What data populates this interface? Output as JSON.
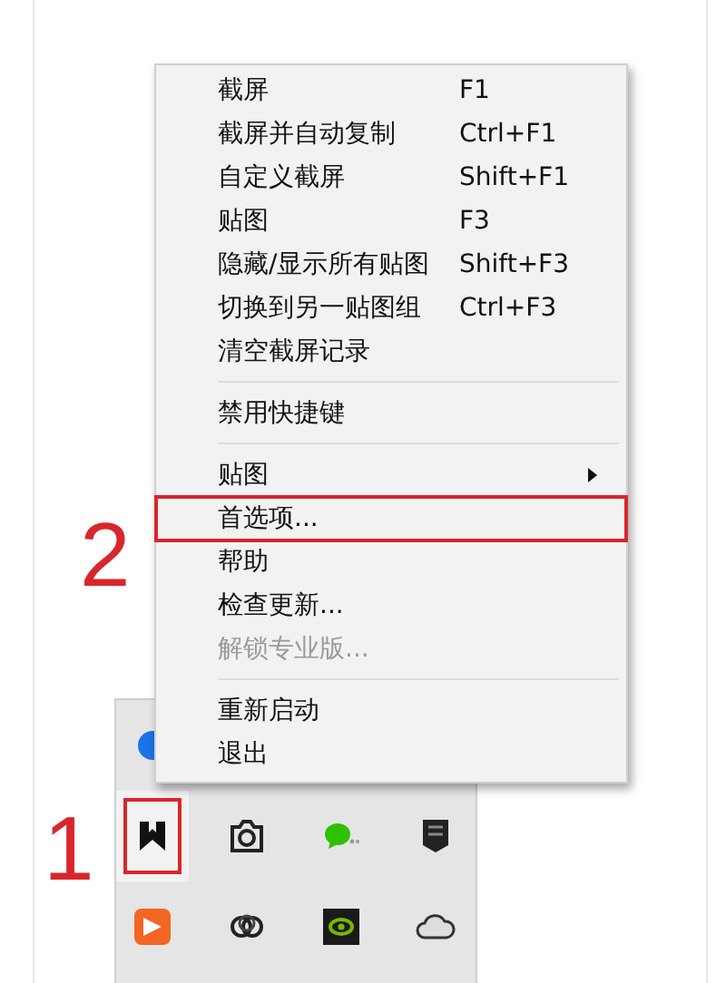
{
  "menu": {
    "items": [
      {
        "kind": "item",
        "label": "截屏",
        "shortcut": "F1",
        "disabled": false,
        "outlined": false
      },
      {
        "kind": "item",
        "label": "截屏并自动复制",
        "shortcut": "Ctrl+F1",
        "disabled": false,
        "outlined": false
      },
      {
        "kind": "item",
        "label": "自定义截屏",
        "shortcut": "Shift+F1",
        "disabled": false,
        "outlined": false
      },
      {
        "kind": "item",
        "label": "贴图",
        "shortcut": "F3",
        "disabled": false,
        "outlined": false
      },
      {
        "kind": "item",
        "label": "隐藏/显示所有贴图",
        "shortcut": "Shift+F3",
        "disabled": false,
        "outlined": false
      },
      {
        "kind": "item",
        "label": "切换到另一贴图组",
        "shortcut": "Ctrl+F3",
        "disabled": false,
        "outlined": false
      },
      {
        "kind": "item",
        "label": "清空截屏记录",
        "disabled": false,
        "outlined": false
      },
      {
        "kind": "separator"
      },
      {
        "kind": "item",
        "label": "禁用快捷键",
        "disabled": false,
        "outlined": false
      },
      {
        "kind": "separator"
      },
      {
        "kind": "submenu",
        "label": "贴图",
        "disabled": false,
        "outlined": false
      },
      {
        "kind": "item",
        "label": "首选项...",
        "disabled": false,
        "outlined": true
      },
      {
        "kind": "item",
        "label": "帮助",
        "disabled": false,
        "outlined": false
      },
      {
        "kind": "item",
        "label": "检查更新...",
        "disabled": false,
        "outlined": false
      },
      {
        "kind": "item",
        "label": "解锁专业版...",
        "disabled": true,
        "outlined": false
      },
      {
        "kind": "separator"
      },
      {
        "kind": "item",
        "label": "重新启动",
        "disabled": false,
        "outlined": false
      },
      {
        "kind": "item",
        "label": "退出",
        "disabled": false,
        "outlined": false
      }
    ]
  },
  "tray": {
    "icons": [
      {
        "kind": "circle",
        "outlined": false
      },
      {
        "kind": "hidden"
      },
      {
        "kind": "hidden"
      },
      {
        "kind": "hidden"
      },
      {
        "kind": "bookmark",
        "outlined": true
      },
      {
        "kind": "camera",
        "outlined": false
      },
      {
        "kind": "chat",
        "outlined": false
      },
      {
        "kind": "shield",
        "outlined": false
      },
      {
        "kind": "play",
        "outlined": false
      },
      {
        "kind": "rings",
        "outlined": false
      },
      {
        "kind": "eye",
        "outlined": false
      },
      {
        "kind": "cloud",
        "outlined": false
      }
    ]
  },
  "annotations": [
    {
      "label": "1"
    },
    {
      "label": "2"
    }
  ]
}
